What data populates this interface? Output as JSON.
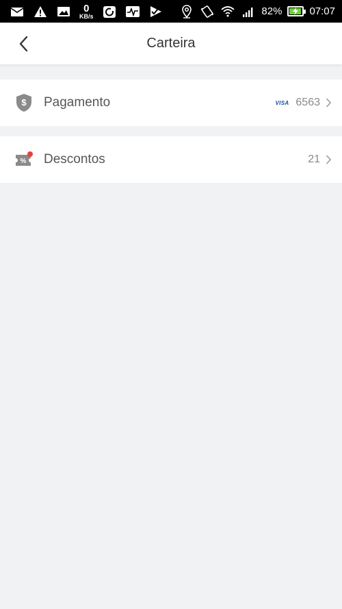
{
  "status_bar": {
    "network_speed_value": "0",
    "network_speed_unit": "KB/s",
    "battery_percent": "82%",
    "time": "07:07"
  },
  "header": {
    "title": "Carteira"
  },
  "menu": {
    "payment": {
      "label": "Pagamento",
      "card_brand": "VISA",
      "card_last_digits": "6563"
    },
    "discounts": {
      "label": "Descontos",
      "count": "21"
    }
  },
  "colors": {
    "background": "#f1f2f4",
    "surface": "#ffffff",
    "icon_gray": "#8a8a8a",
    "badge_red": "#e8413c",
    "visa_blue": "#1a4fa0"
  }
}
